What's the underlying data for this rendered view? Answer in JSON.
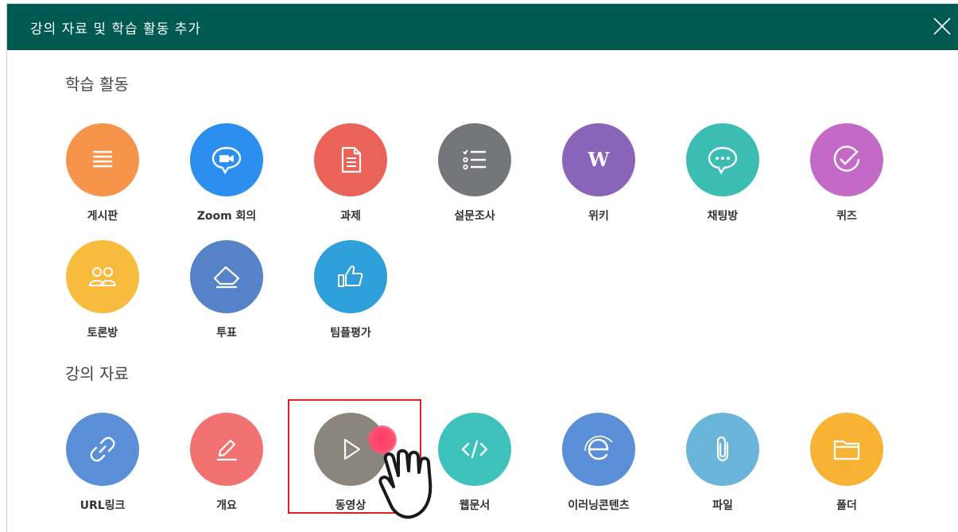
{
  "colors": {
    "header": "#015a52",
    "board": "#f5944a",
    "zoom": "#2c8ff0",
    "assignment": "#ea6258",
    "survey": "#75767a",
    "wiki": "#8a64b8",
    "chat": "#3cbdb3",
    "quiz": "#c46ac6",
    "discussion": "#f7bb3e",
    "vote": "#5682c8",
    "team": "#2f9fd9",
    "url": "#5a8ed6",
    "outline": "#f27272",
    "video": "#8a867e",
    "webdoc": "#3fc1bb",
    "elearning": "#5a8ed6",
    "file": "#6ab3d9",
    "folder": "#f8b335",
    "highlight": "#e02020"
  },
  "header": {
    "title": "강의 자료 및 학습 활동 추가"
  },
  "sections": {
    "activities": {
      "title": "학습 활동"
    },
    "materials": {
      "title": "강의 자료"
    }
  },
  "activities": [
    {
      "label": "게시판",
      "icon": "list-icon"
    },
    {
      "label": "Zoom 회의",
      "icon": "video-chat-icon"
    },
    {
      "label": "과제",
      "icon": "document-icon"
    },
    {
      "label": "설문조사",
      "icon": "checklist-icon"
    },
    {
      "label": "위키",
      "icon": "wiki-w-icon"
    },
    {
      "label": "채팅방",
      "icon": "chat-bubble-icon"
    },
    {
      "label": "퀴즈",
      "icon": "check-circle-icon"
    },
    {
      "label": "토론방",
      "icon": "people-icon"
    },
    {
      "label": "투표",
      "icon": "eraser-icon"
    },
    {
      "label": "팀플평가",
      "icon": "thumbs-up-icon"
    }
  ],
  "materials": [
    {
      "label": "URL링크",
      "icon": "link-icon"
    },
    {
      "label": "개요",
      "icon": "pencil-icon"
    },
    {
      "label": "동영상",
      "icon": "play-icon"
    },
    {
      "label": "웹문서",
      "icon": "code-icon"
    },
    {
      "label": "이러닝콘텐츠",
      "icon": "e-icon"
    },
    {
      "label": "파일",
      "icon": "paperclip-icon"
    },
    {
      "label": "폴더",
      "icon": "folder-icon"
    }
  ]
}
